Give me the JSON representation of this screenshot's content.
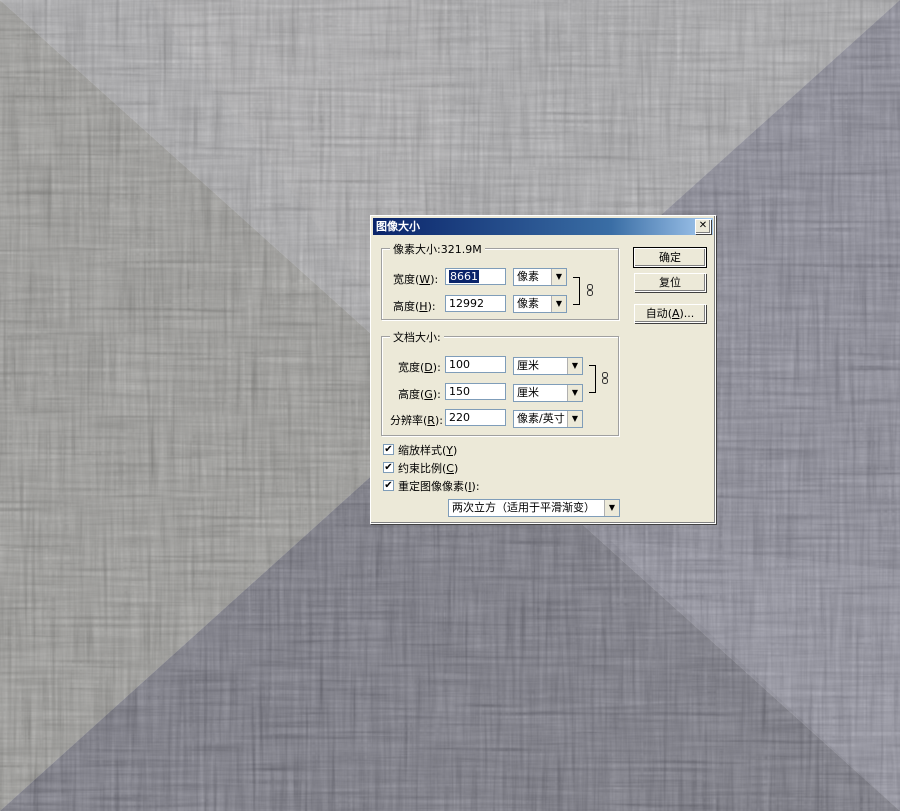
{
  "dialog": {
    "title": "图像大小",
    "close_glyph": "✕",
    "pixel_dimensions": {
      "label": "像素大小:321.9M",
      "width_label": "宽度",
      "width_key": "W",
      "width_value": "8661",
      "width_unit": "像素",
      "height_label": "高度",
      "height_key": "H",
      "height_value": "12992",
      "height_unit": "像素"
    },
    "document_size": {
      "label": "文档大小:",
      "width_label": "宽度",
      "width_key": "D",
      "width_value": "100",
      "width_unit": "厘米",
      "height_label": "高度",
      "height_key": "G",
      "height_value": "150",
      "height_unit": "厘米",
      "resolution_label": "分辨率",
      "resolution_key": "R",
      "resolution_value": "220",
      "resolution_unit": "像素/英寸"
    },
    "buttons": {
      "ok": "确定",
      "reset": "复位",
      "auto_label": "自动",
      "auto_key": "A"
    },
    "options": {
      "scale_styles_label": "缩放样式",
      "scale_styles_key": "Y",
      "scale_styles_checked": true,
      "constrain_label": "约束比例",
      "constrain_key": "C",
      "constrain_checked": true,
      "resample_label": "重定图像像素",
      "resample_key": "I",
      "resample_checked": true,
      "resample_method": "两次立方（适用于平滑渐变）"
    }
  },
  "colors": {
    "titlebar": "#0a246a",
    "dialog_bg": "#ece9d8",
    "canvas_grey": "#8c8b87",
    "canvas_navy": "#5a5a72"
  },
  "icons": {
    "dropdown": "▼",
    "check": "✔",
    "chain": "chain-link-icon"
  }
}
